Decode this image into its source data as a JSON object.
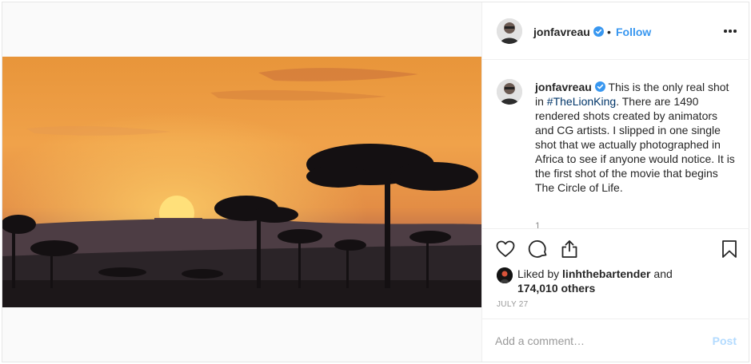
{
  "post": {
    "username": "jonfavreau",
    "dot": "•",
    "follow_label": "Follow",
    "caption_username": "jonfavreau",
    "caption_before": " This is the only real shot in ",
    "hashtag": "#TheLionKing",
    "caption_after": ". There are 1490 rendered shots created by animators and CG artists. I slipped in one single shot that we actually photographed in Africa to see if anyone would notice. It is the first shot of the movie that begins The Circle of Life.",
    "scroll_hint": "1",
    "liked_by_prefix": "Liked by ",
    "liked_by_user": "linhthebartender",
    "liked_by_and": " and",
    "likes_count": "174,010 others",
    "date": "JULY 27",
    "comment_placeholder": "Add a comment…",
    "post_label": "Post"
  },
  "icons": {
    "more": "more-options-icon",
    "verified": "verified-badge-icon",
    "like": "heart-icon",
    "comment": "comment-icon",
    "share": "share-icon",
    "save": "bookmark-icon"
  },
  "colors": {
    "link": "#3897f0",
    "hashtag": "#003569",
    "post_disabled": "#b3dbff",
    "muted": "#999999",
    "verified": "#3897f0"
  }
}
